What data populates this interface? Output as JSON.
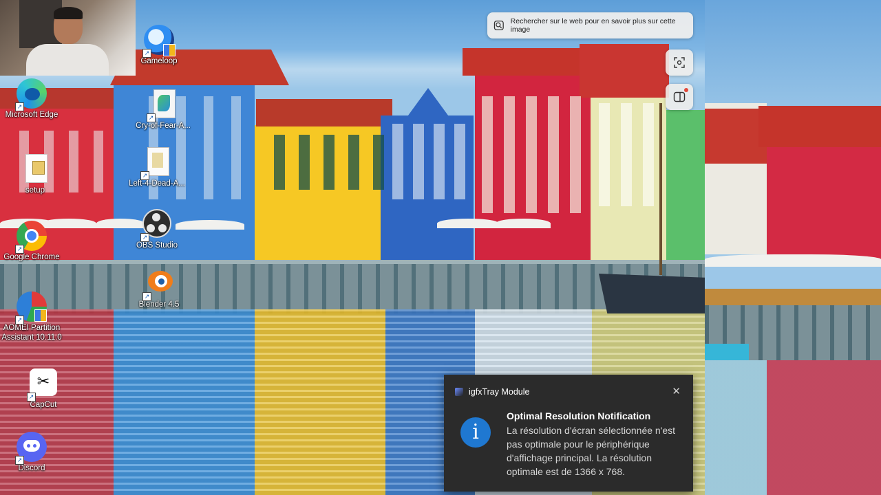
{
  "desktop": {
    "icons": [
      {
        "label": "Gameloop",
        "icon": "gameloop-icon"
      },
      {
        "label": "Microsoft Edge",
        "icon": "edge-icon"
      },
      {
        "label": "Cry-of-Fear-A...",
        "icon": "file-icon"
      },
      {
        "label": "setup",
        "icon": "setup-icon"
      },
      {
        "label": "Left-4-Dead-A...",
        "icon": "file-icon"
      },
      {
        "label": "Google Chrome",
        "icon": "chrome-icon"
      },
      {
        "label": "OBS Studio",
        "icon": "obs-icon"
      },
      {
        "label": "Blender 4.5",
        "icon": "blender-icon"
      },
      {
        "label": "AOMEI Partition Assistant 10.11.0",
        "icon": "aomei-icon"
      },
      {
        "label": "CapCut",
        "icon": "capcut-icon"
      },
      {
        "label": "Discord",
        "icon": "discord-icon"
      }
    ]
  },
  "lens": {
    "search_label": "Rechercher sur le web pour en savoir plus sur cette image"
  },
  "toast": {
    "app_name": "igfxTray Module",
    "title": "Optimal Resolution Notification",
    "body": "La résolution d'écran sélectionnée n'est pas optimale pour le périphérique d'affichage principal. La résolution optimale est de 1366 x 768.",
    "close_glyph": "✕",
    "info_glyph": "i"
  },
  "colors": {
    "toast_bg": "#2b2b2b",
    "info_blue": "#1f78d1",
    "discord": "#5865f2",
    "chrome_red": "#ea4335",
    "chrome_yellow": "#fbbc05",
    "chrome_green": "#34a853",
    "chrome_blue": "#4285f4"
  }
}
